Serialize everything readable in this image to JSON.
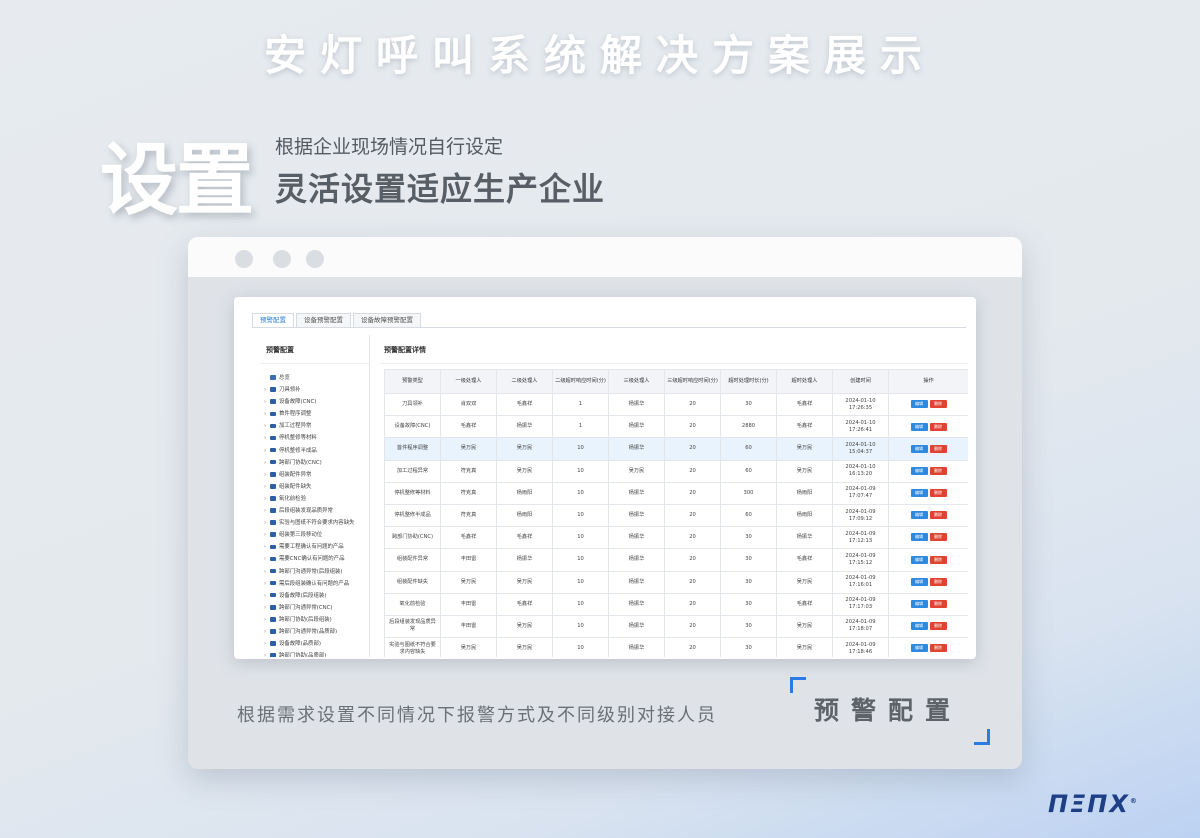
{
  "header": {
    "main_title": "安灯呼叫系统解决方案展示",
    "big_char": "设置",
    "subtitle_small": "根据企业现场情况自行设定",
    "subtitle_large": "灵活设置适应生产企业"
  },
  "app": {
    "tabs": [
      "预警配置",
      "设备预警配置",
      "设备故障预警配置"
    ],
    "left_title": "预警配置",
    "tree": [
      "总览",
      "刀具领补",
      "设备故障(CNC)",
      "首件程序调整",
      "加工过程异常",
      "停机整修等材料",
      "停机整修半成品",
      "跨部门协助(CNC)",
      "组装配件异常",
      "组装配件缺失",
      "氧化前检验",
      "后段组装发现品质异常",
      "实验与图纸不符合要求内容缺失",
      "组装第三段移动位",
      "需要工程确认有问题的产品",
      "需要CNC确认有问题的产品",
      "跨部门沟通异常(后段组装)",
      "需后段组装确认有问题的产品",
      "设备故障(后段组装)",
      "跨部门沟通异常(CNC)",
      "跨部门协助(后段组装)",
      "跨部门沟通异常(品质部)",
      "设备故障(品质部)",
      "跨部门协助(品质部)"
    ],
    "right_title": "预警配置详情",
    "columns": [
      "预警类型",
      "一级处理人",
      "二级处理人",
      "二级超时响应时间(分)",
      "三级处理人",
      "三级超时响应时间(分)",
      "超时处理时长(分)",
      "超时处理人",
      "创建时间",
      "操作"
    ],
    "rows": [
      [
        "刀具领补",
        "肖双双",
        "毛鑫祥",
        "1",
        "杨振华",
        "20",
        "30",
        "毛鑫祥",
        "2024-01-10 17:26:35"
      ],
      [
        "设备故障(CNC)",
        "毛鑫祥",
        "杨振华",
        "1",
        "杨振华",
        "20",
        "2880",
        "毛鑫祥",
        "2024-01-10 17:26:41"
      ],
      [
        "首件程序调整",
        "吴万民",
        "吴万民",
        "10",
        "杨振华",
        "20",
        "60",
        "吴万民",
        "2024-01-10 15:04:37"
      ],
      [
        "加工过程异常",
        "符克真",
        "吴万民",
        "10",
        "吴万民",
        "20",
        "60",
        "吴万民",
        "2024-01-10 16:13:20"
      ],
      [
        "停机整修等材料",
        "符克真",
        "杨雨阳",
        "10",
        "杨振华",
        "20",
        "300",
        "杨雨阳",
        "2024-01-09 17:07:47"
      ],
      [
        "停机整修半成品",
        "符克真",
        "杨雨阳",
        "10",
        "杨振华",
        "20",
        "60",
        "杨雨阳",
        "2024-01-09 17:09:12"
      ],
      [
        "跨部门协助(CNC)",
        "毛鑫祥",
        "毛鑫祥",
        "10",
        "杨振华",
        "20",
        "30",
        "杨振华",
        "2024-01-09 17:12:13"
      ],
      [
        "组装配件异常",
        "丰田雷",
        "杨振华",
        "10",
        "杨振华",
        "20",
        "30",
        "毛鑫祥",
        "2024-01-09 17:15:12"
      ],
      [
        "组装配件缺失",
        "吴万民",
        "吴万民",
        "10",
        "杨振华",
        "20",
        "30",
        "吴万民",
        "2024-01-09 17:16:01"
      ],
      [
        "氧化前检验",
        "丰田雷",
        "毛鑫祥",
        "10",
        "杨振华",
        "20",
        "30",
        "毛鑫祥",
        "2024-01-09 17:17:03"
      ],
      [
        "后段组装发现品质异常",
        "丰田雷",
        "吴万民",
        "10",
        "杨振华",
        "20",
        "30",
        "吴万民",
        "2024-01-09 17:18:07"
      ],
      [
        "实验与图纸不符合要求内容缺失",
        "吴万民",
        "吴万民",
        "10",
        "杨振华",
        "20",
        "30",
        "吴万民",
        "2024-01-09 17:18:46"
      ]
    ],
    "highlight_row": 2,
    "edit_label": "编辑",
    "delete_label": "删除"
  },
  "caption": "根据需求设置不同情况下报警方式及不同级别对接人员",
  "badge": "预警配置",
  "logo": "ΠΞΠΧ",
  "colors": {
    "accent": "#2c7be5",
    "delete": "#e0432f",
    "edit": "#2d8ae0"
  }
}
